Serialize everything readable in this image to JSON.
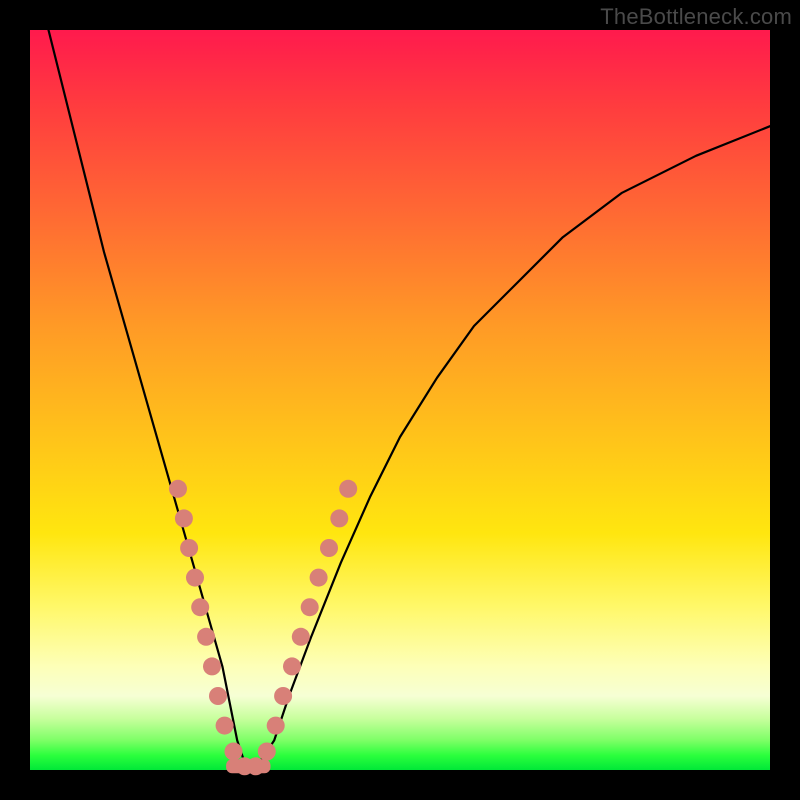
{
  "watermark": "TheBottleneck.com",
  "chart_data": {
    "type": "line",
    "title": "",
    "xlabel": "",
    "ylabel": "",
    "xlim": [
      0,
      100
    ],
    "ylim": [
      0,
      100
    ],
    "gradient_colors": {
      "top": "#ff1a4d",
      "mid_upper": "#ff9a26",
      "mid": "#ffe60f",
      "mid_lower": "#fdffb8",
      "bottom": "#00e838"
    },
    "series": [
      {
        "name": "bottleneck-curve",
        "x": [
          0,
          2,
          4,
          6,
          8,
          10,
          12,
          14,
          16,
          18,
          20,
          22,
          24,
          26,
          27,
          28,
          29,
          30,
          31,
          33,
          35,
          38,
          42,
          46,
          50,
          55,
          60,
          66,
          72,
          80,
          90,
          100
        ],
        "y": [
          110,
          102,
          94,
          86,
          78,
          70,
          63,
          56,
          49,
          42,
          35,
          28,
          21,
          14,
          9,
          4,
          1,
          0,
          1,
          4,
          10,
          18,
          28,
          37,
          45,
          53,
          60,
          66,
          72,
          78,
          83,
          87
        ]
      }
    ],
    "markers": {
      "name": "highlight-dots",
      "color": "#d88078",
      "points": [
        {
          "x": 20.0,
          "y": 38
        },
        {
          "x": 20.8,
          "y": 34
        },
        {
          "x": 21.5,
          "y": 30
        },
        {
          "x": 22.3,
          "y": 26
        },
        {
          "x": 23.0,
          "y": 22
        },
        {
          "x": 23.8,
          "y": 18
        },
        {
          "x": 24.6,
          "y": 14
        },
        {
          "x": 25.4,
          "y": 10
        },
        {
          "x": 26.3,
          "y": 6
        },
        {
          "x": 27.5,
          "y": 2.5
        },
        {
          "x": 29.0,
          "y": 0.5
        },
        {
          "x": 30.5,
          "y": 0.5
        },
        {
          "x": 32.0,
          "y": 2.5
        },
        {
          "x": 33.2,
          "y": 6
        },
        {
          "x": 34.2,
          "y": 10
        },
        {
          "x": 35.4,
          "y": 14
        },
        {
          "x": 36.6,
          "y": 18
        },
        {
          "x": 37.8,
          "y": 22
        },
        {
          "x": 39.0,
          "y": 26
        },
        {
          "x": 40.4,
          "y": 30
        },
        {
          "x": 41.8,
          "y": 34
        },
        {
          "x": 43.0,
          "y": 38
        }
      ]
    },
    "bottom_bar": {
      "x_start": 26.5,
      "x_end": 32.5,
      "y": 0.5,
      "color": "#d88078"
    }
  }
}
